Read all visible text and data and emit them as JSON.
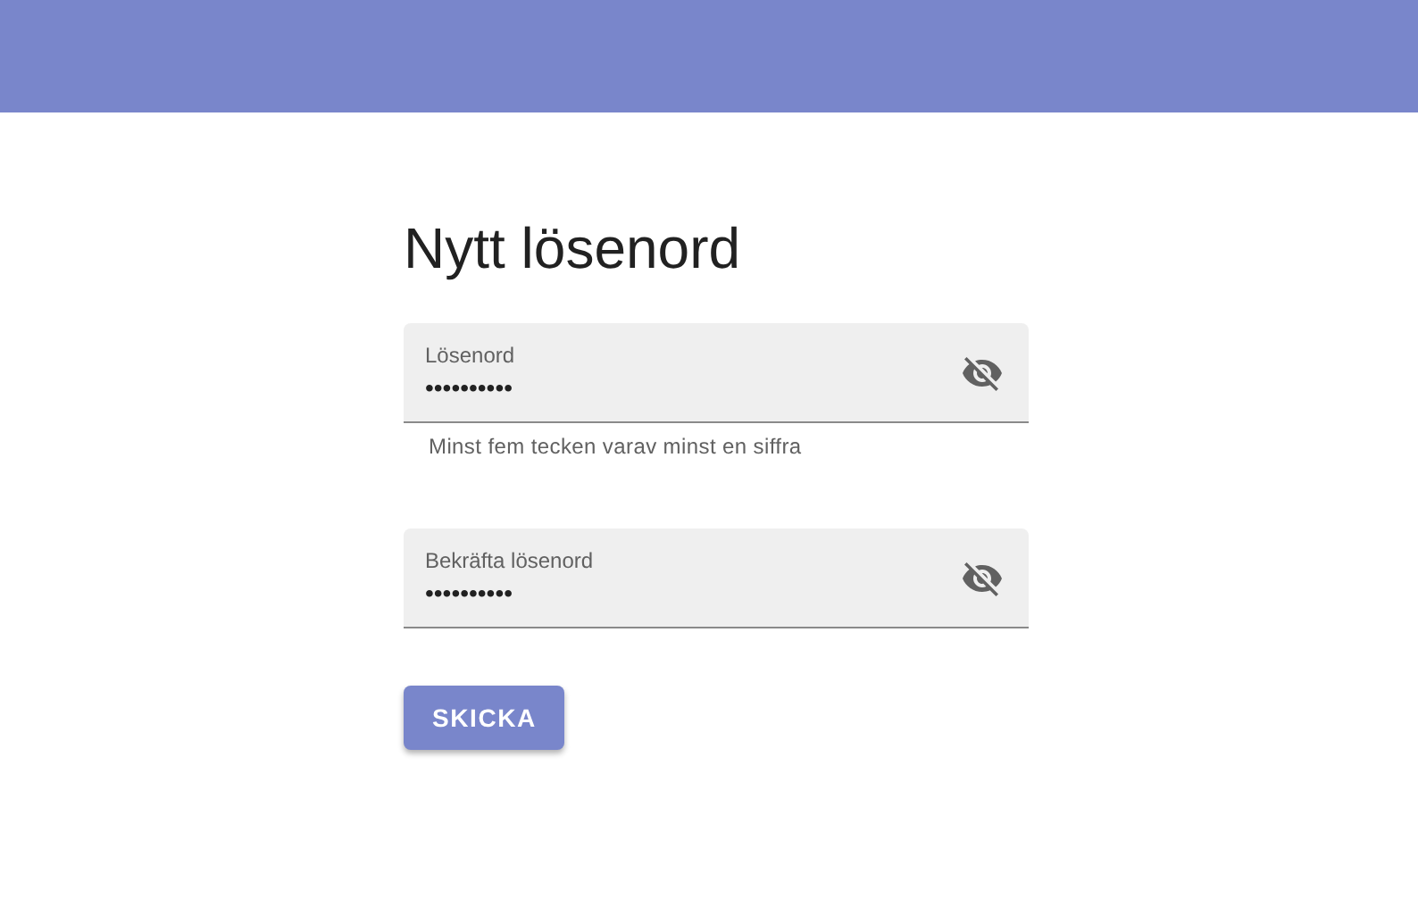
{
  "page": {
    "title": "Nytt lösenord"
  },
  "fields": [
    {
      "label": "Lösenord",
      "value": "••••••••••",
      "helper": "Minst fem tecken varav minst en siffra"
    },
    {
      "label": "Bekräfta lösenord",
      "value": "••••••••••"
    }
  ],
  "submit": {
    "label": "SKICKA"
  }
}
